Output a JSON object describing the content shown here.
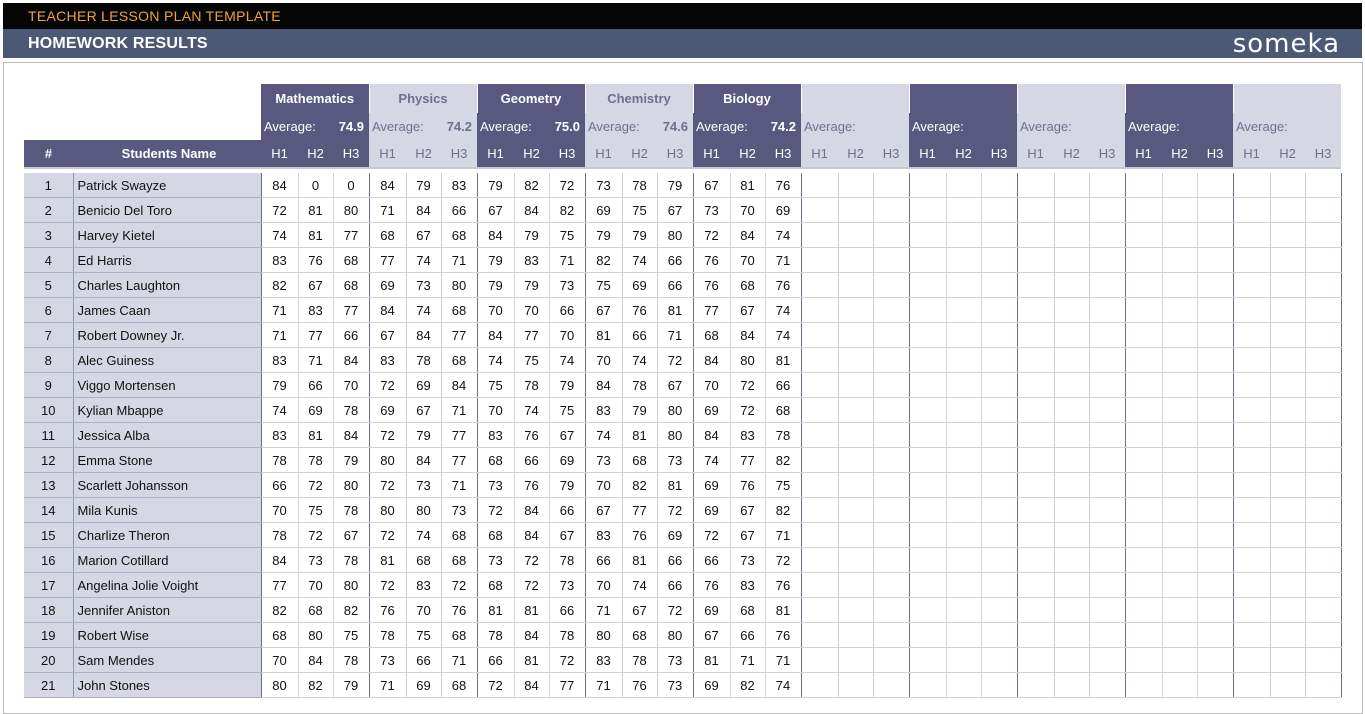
{
  "topbar": {
    "title": "TEACHER LESSON PLAN TEMPLATE"
  },
  "header": {
    "title": "HOMEWORK RESULTS",
    "logo": "someka"
  },
  "colors": {
    "dark": "#59587f",
    "light": "#d5d7e4",
    "topbar_text": "#f0a23b",
    "header_bg": "#4b5975"
  },
  "table": {
    "num_header": "#",
    "name_header": "Students Name",
    "average_label": "Average:",
    "hw_labels": [
      "H1",
      "H2",
      "H3"
    ],
    "subjects": [
      {
        "name": "Mathematics",
        "average": "74.9"
      },
      {
        "name": "Physics",
        "average": "74.2"
      },
      {
        "name": "Geometry",
        "average": "75.0"
      },
      {
        "name": "Chemistry",
        "average": "74.6"
      },
      {
        "name": "Biology",
        "average": "74.2"
      },
      {
        "name": "",
        "average": ""
      },
      {
        "name": "",
        "average": ""
      },
      {
        "name": "",
        "average": ""
      },
      {
        "name": "",
        "average": ""
      },
      {
        "name": "",
        "average": ""
      }
    ],
    "students": [
      {
        "num": "1",
        "name": "Patrick Swayze",
        "scores": [
          [
            84,
            0,
            0
          ],
          [
            84,
            79,
            83
          ],
          [
            79,
            82,
            72
          ],
          [
            73,
            78,
            79
          ],
          [
            67,
            81,
            76
          ]
        ]
      },
      {
        "num": "2",
        "name": "Benicio Del Toro",
        "scores": [
          [
            72,
            81,
            80
          ],
          [
            71,
            84,
            66
          ],
          [
            67,
            84,
            82
          ],
          [
            69,
            75,
            67
          ],
          [
            73,
            70,
            69
          ]
        ]
      },
      {
        "num": "3",
        "name": "Harvey Kietel",
        "scores": [
          [
            74,
            81,
            77
          ],
          [
            68,
            67,
            68
          ],
          [
            84,
            79,
            75
          ],
          [
            79,
            79,
            80
          ],
          [
            72,
            84,
            74
          ]
        ]
      },
      {
        "num": "4",
        "name": "Ed Harris",
        "scores": [
          [
            83,
            76,
            68
          ],
          [
            77,
            74,
            71
          ],
          [
            79,
            83,
            71
          ],
          [
            82,
            74,
            66
          ],
          [
            76,
            70,
            71
          ]
        ]
      },
      {
        "num": "5",
        "name": "Charles Laughton",
        "scores": [
          [
            82,
            67,
            68
          ],
          [
            69,
            73,
            80
          ],
          [
            79,
            79,
            73
          ],
          [
            75,
            69,
            66
          ],
          [
            76,
            68,
            76
          ]
        ]
      },
      {
        "num": "6",
        "name": "James Caan",
        "scores": [
          [
            71,
            83,
            77
          ],
          [
            84,
            74,
            68
          ],
          [
            70,
            70,
            66
          ],
          [
            67,
            76,
            81
          ],
          [
            77,
            67,
            74
          ]
        ]
      },
      {
        "num": "7",
        "name": "Robert Downey Jr.",
        "scores": [
          [
            71,
            77,
            66
          ],
          [
            67,
            84,
            77
          ],
          [
            84,
            77,
            70
          ],
          [
            81,
            66,
            71
          ],
          [
            68,
            84,
            74
          ]
        ]
      },
      {
        "num": "8",
        "name": "Alec Guiness",
        "scores": [
          [
            83,
            71,
            84
          ],
          [
            83,
            78,
            68
          ],
          [
            74,
            75,
            74
          ],
          [
            70,
            74,
            72
          ],
          [
            84,
            80,
            81
          ]
        ]
      },
      {
        "num": "9",
        "name": "Viggo Mortensen",
        "scores": [
          [
            79,
            66,
            70
          ],
          [
            72,
            69,
            84
          ],
          [
            75,
            78,
            79
          ],
          [
            84,
            78,
            67
          ],
          [
            70,
            72,
            66
          ]
        ]
      },
      {
        "num": "10",
        "name": "Kylian Mbappe",
        "scores": [
          [
            74,
            69,
            78
          ],
          [
            69,
            67,
            71
          ],
          [
            70,
            74,
            75
          ],
          [
            83,
            79,
            80
          ],
          [
            69,
            72,
            68
          ]
        ]
      },
      {
        "num": "11",
        "name": "Jessica Alba",
        "scores": [
          [
            83,
            81,
            84
          ],
          [
            72,
            79,
            77
          ],
          [
            83,
            76,
            67
          ],
          [
            74,
            81,
            80
          ],
          [
            84,
            83,
            78
          ]
        ]
      },
      {
        "num": "12",
        "name": "Emma Stone",
        "scores": [
          [
            78,
            78,
            79
          ],
          [
            80,
            84,
            77
          ],
          [
            68,
            66,
            69
          ],
          [
            73,
            68,
            73
          ],
          [
            74,
            77,
            82
          ]
        ]
      },
      {
        "num": "13",
        "name": "Scarlett Johansson",
        "scores": [
          [
            66,
            72,
            80
          ],
          [
            72,
            73,
            71
          ],
          [
            73,
            76,
            79
          ],
          [
            70,
            82,
            81
          ],
          [
            69,
            76,
            75
          ]
        ]
      },
      {
        "num": "14",
        "name": "Mila Kunis",
        "scores": [
          [
            70,
            75,
            78
          ],
          [
            80,
            80,
            73
          ],
          [
            72,
            84,
            66
          ],
          [
            67,
            77,
            72
          ],
          [
            69,
            67,
            82
          ]
        ]
      },
      {
        "num": "15",
        "name": "Charlize Theron",
        "scores": [
          [
            78,
            72,
            67
          ],
          [
            72,
            74,
            68
          ],
          [
            68,
            84,
            67
          ],
          [
            83,
            76,
            69
          ],
          [
            72,
            67,
            71
          ]
        ]
      },
      {
        "num": "16",
        "name": "Marion Cotillard",
        "scores": [
          [
            84,
            73,
            78
          ],
          [
            81,
            68,
            68
          ],
          [
            73,
            72,
            78
          ],
          [
            66,
            81,
            66
          ],
          [
            66,
            73,
            72
          ]
        ]
      },
      {
        "num": "17",
        "name": "Angelina Jolie Voight",
        "scores": [
          [
            77,
            70,
            80
          ],
          [
            72,
            83,
            72
          ],
          [
            68,
            72,
            73
          ],
          [
            70,
            74,
            66
          ],
          [
            76,
            83,
            76
          ]
        ]
      },
      {
        "num": "18",
        "name": "Jennifer Aniston",
        "scores": [
          [
            82,
            68,
            82
          ],
          [
            76,
            70,
            76
          ],
          [
            81,
            81,
            66
          ],
          [
            71,
            67,
            72
          ],
          [
            69,
            68,
            81
          ]
        ]
      },
      {
        "num": "19",
        "name": "Robert Wise",
        "scores": [
          [
            68,
            80,
            75
          ],
          [
            78,
            75,
            68
          ],
          [
            78,
            84,
            78
          ],
          [
            80,
            68,
            80
          ],
          [
            67,
            66,
            76
          ]
        ]
      },
      {
        "num": "20",
        "name": "Sam Mendes",
        "scores": [
          [
            70,
            84,
            78
          ],
          [
            73,
            66,
            71
          ],
          [
            66,
            81,
            72
          ],
          [
            83,
            78,
            73
          ],
          [
            81,
            71,
            71
          ]
        ]
      },
      {
        "num": "21",
        "name": "John Stones",
        "scores": [
          [
            80,
            82,
            79
          ],
          [
            71,
            69,
            68
          ],
          [
            72,
            84,
            77
          ],
          [
            71,
            76,
            73
          ],
          [
            69,
            82,
            74
          ]
        ]
      }
    ]
  }
}
